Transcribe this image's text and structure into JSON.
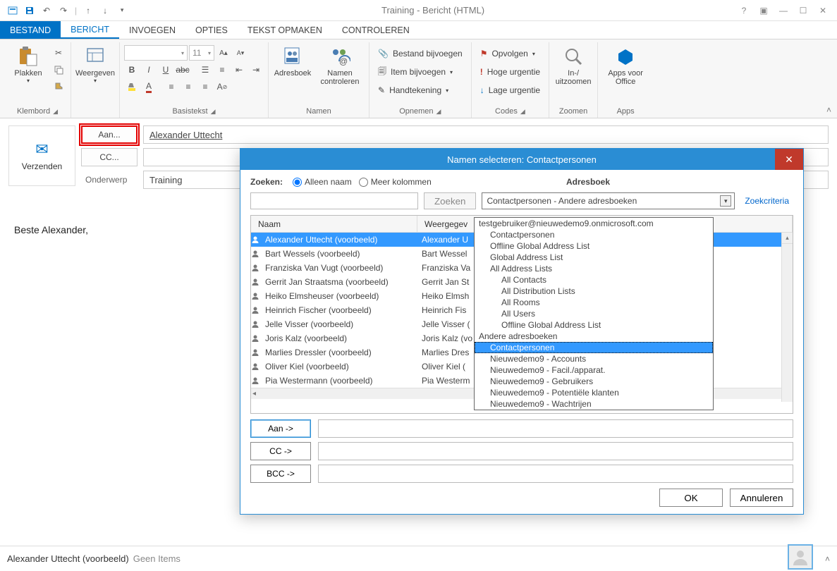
{
  "window": {
    "title": "Training - Bericht (HTML)"
  },
  "tabs": {
    "file": "BESTAND",
    "message": "BERICHT",
    "insert": "INVOEGEN",
    "options": "OPTIES",
    "format": "TEKST OPMAKEN",
    "review": "CONTROLEREN"
  },
  "ribbon": {
    "clipboard": {
      "label": "Klembord",
      "paste": "Plakken"
    },
    "view": {
      "label": "",
      "show": "Weergeven"
    },
    "font": {
      "label": "Basistekst",
      "size": "11"
    },
    "names": {
      "label": "Namen",
      "addressbook": "Adresboek",
      "checknames": "Namen controleren"
    },
    "include": {
      "label": "Opnemen",
      "attach_file": "Bestand bijvoegen",
      "attach_item": "Item bijvoegen",
      "signature": "Handtekening"
    },
    "tags": {
      "label": "Codes",
      "followup": "Opvolgen",
      "high": "Hoge urgentie",
      "low": "Lage urgentie"
    },
    "zoom": {
      "label": "Zoomen",
      "zoom": "In-/ uitzoomen"
    },
    "apps": {
      "label": "Apps",
      "apps": "Apps voor Office"
    }
  },
  "compose": {
    "send": "Verzenden",
    "to_btn": "Aan...",
    "cc_btn": "CC...",
    "subject_label": "Onderwerp",
    "to_value": "Alexander Uttecht",
    "subject_value": "Training",
    "body": "Beste Alexander,"
  },
  "dialog": {
    "title": "Namen selecteren: Contactpersonen",
    "search_label": "Zoeken:",
    "radio_name": "Alleen naam",
    "radio_more": "Meer kolommen",
    "addressbook_label": "Adresboek",
    "search_btn": "Zoeken",
    "ab_selected": "Contactpersonen - Andere adresboeken",
    "criteria_link": "Zoekcriteria",
    "col_name": "Naam",
    "col_display": "Weergegev",
    "to_btn": "Aan ->",
    "cc_btn": "CC ->",
    "bcc_btn": "BCC ->",
    "ok": "OK",
    "cancel": "Annuleren",
    "contacts": [
      {
        "name": "Alexander Uttecht (voorbeeld)",
        "display": "Alexander U",
        "selected": true
      },
      {
        "name": "Bart Wessels (voorbeeld)",
        "display": "Bart Wessel"
      },
      {
        "name": "Franziska Van Vugt (voorbeeld)",
        "display": "Franziska Va"
      },
      {
        "name": "Gerrit Jan Straatsma (voorbeeld)",
        "display": "Gerrit Jan St"
      },
      {
        "name": "Heiko Elmsheuser (voorbeeld)",
        "display": "Heiko Elmsh"
      },
      {
        "name": "Heinrich Fischer (voorbeeld)",
        "display": "Heinrich Fis"
      },
      {
        "name": "Jelle Visser (voorbeeld)",
        "display": "Jelle Visser ("
      },
      {
        "name": "Joris Kalz (voorbeeld)",
        "display": "Joris Kalz (vo"
      },
      {
        "name": "Marlies Dressler (voorbeeld)",
        "display": "Marlies Dres"
      },
      {
        "name": "Oliver Kiel (voorbeeld)",
        "display": "Oliver Kiel ("
      },
      {
        "name": "Pia Westermann (voorbeeld)",
        "display": "Pia Westerm"
      }
    ]
  },
  "dropdown": {
    "items": [
      {
        "label": "testgebruiker@nieuwedemo9.onmicrosoft.com",
        "indent": 0
      },
      {
        "label": "Contactpersonen",
        "indent": 1
      },
      {
        "label": "Offline Global Address List",
        "indent": 1
      },
      {
        "label": "Global Address List",
        "indent": 1
      },
      {
        "label": "All Address Lists",
        "indent": 1
      },
      {
        "label": "All Contacts",
        "indent": 2
      },
      {
        "label": "All Distribution Lists",
        "indent": 2
      },
      {
        "label": "All Rooms",
        "indent": 2
      },
      {
        "label": "All Users",
        "indent": 2
      },
      {
        "label": "Offline Global Address List",
        "indent": 2
      },
      {
        "label": "Andere adresboeken",
        "indent": 0
      },
      {
        "label": "Contactpersonen",
        "indent": 1,
        "selected": true
      },
      {
        "label": "Nieuwedemo9 - Accounts",
        "indent": 1
      },
      {
        "label": "Nieuwedemo9 - Facil./apparat.",
        "indent": 1
      },
      {
        "label": "Nieuwedemo9 - Gebruikers",
        "indent": 1
      },
      {
        "label": "Nieuwedemo9 - Potentiële klanten",
        "indent": 1
      },
      {
        "label": "Nieuwedemo9 - Wachtrijen",
        "indent": 1
      }
    ]
  },
  "status": {
    "name": "Alexander Uttecht (voorbeeld)",
    "items": "Geen Items"
  }
}
